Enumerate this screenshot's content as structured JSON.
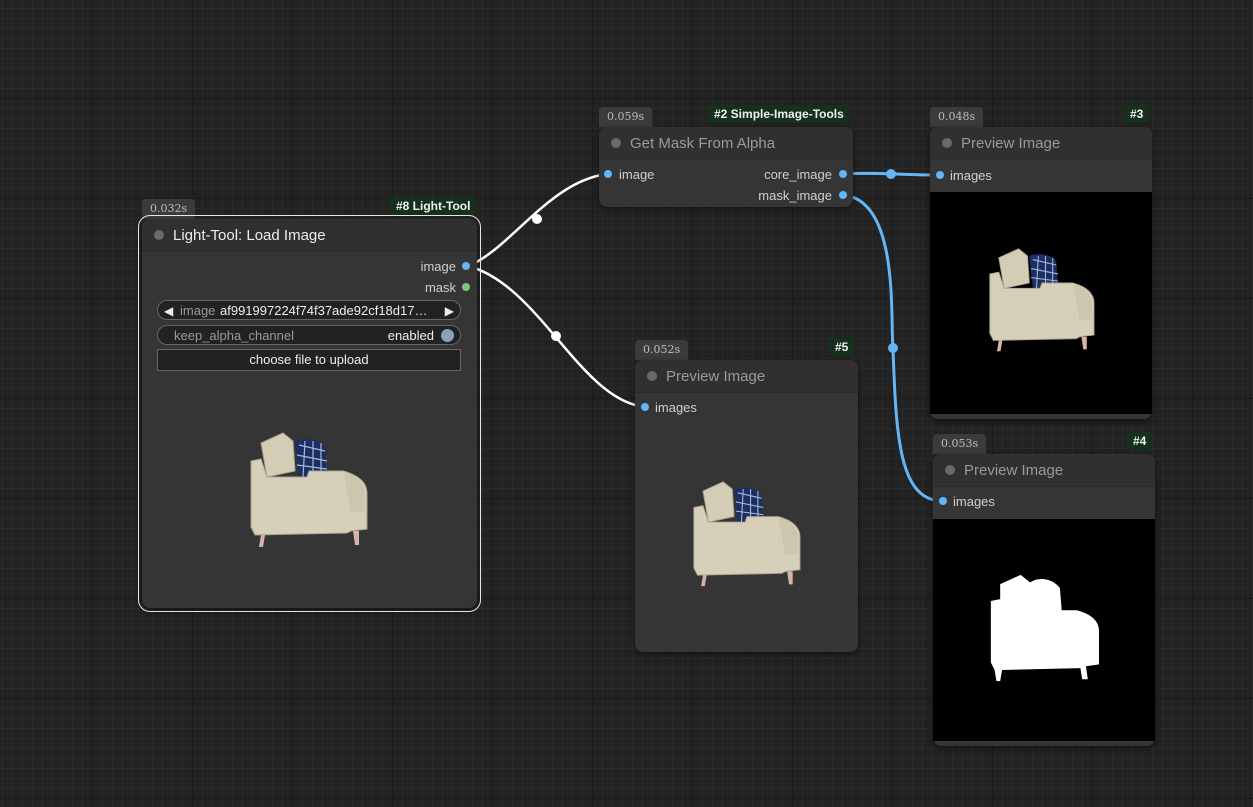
{
  "nodes": {
    "load": {
      "timing": "0.032s",
      "badge": "#8 Light-Tool",
      "title": "Light-Tool: Load Image",
      "out_image": "image",
      "out_mask": "mask",
      "image_widget_label": "image",
      "image_widget_value": "af991997224f74f37ade92cf18d17…",
      "alpha_label": "keep_alpha_channel",
      "alpha_value": "enabled",
      "upload_label": "choose file to upload"
    },
    "mask": {
      "timing": "0.059s",
      "badge": "#2 Simple-Image-Tools",
      "title": "Get Mask From Alpha",
      "in_image": "image",
      "out_core": "core_image",
      "out_mask": "mask_image"
    },
    "preview5": {
      "timing": "0.052s",
      "badge": "#5",
      "title": "Preview Image",
      "in_images": "images"
    },
    "preview3": {
      "timing": "0.048s",
      "badge": "#3",
      "title": "Preview Image",
      "in_images": "images"
    },
    "preview4": {
      "timing": "0.053s",
      "badge": "#4",
      "title": "Preview Image",
      "in_images": "images"
    }
  },
  "colors": {
    "canvas": "#222222",
    "node": "#353535",
    "image_wire": "#64b5f6",
    "selected_wire": "#ffffff",
    "mask_dot": "#7bc67b",
    "badge_bg": "#15301c"
  },
  "icons": {
    "arrow_left": "left-arrow-icon",
    "arrow_right": "right-arrow-icon",
    "toggle": "toggle-knob-icon"
  }
}
